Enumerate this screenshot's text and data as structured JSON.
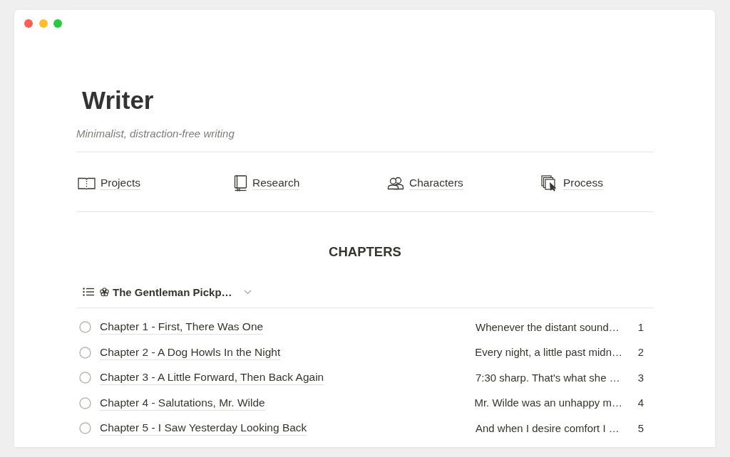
{
  "window": {
    "buttons": [
      {
        "color": "#fe5f57"
      },
      {
        "color": "#febc2e"
      },
      {
        "color": "#28c840"
      }
    ]
  },
  "page": {
    "title": "Writer",
    "subtitle": "Minimalist, distraction-free writing"
  },
  "links": [
    {
      "label": "Projects",
      "kind": "book"
    },
    {
      "label": "Research",
      "kind": "notebook"
    },
    {
      "label": "Characters",
      "kind": "people"
    },
    {
      "label": "Process",
      "kind": "pages"
    }
  ],
  "chapters": {
    "heading": "CHAPTERS",
    "view": {
      "label": "The Gentleman Pickp…"
    },
    "rows": [
      {
        "checked": false,
        "title": "Chapter 1 - First, There Was One",
        "column_2": "Whenever the distant sound…",
        "column_3": "1"
      },
      {
        "checked": false,
        "title": "Chapter 2 - A Dog Howls In the Night",
        "column_2": "Every night, a little past midn…",
        "column_3": "2"
      },
      {
        "checked": false,
        "title": "Chapter 3 - A Little Forward, Then Back Again",
        "column_2": "7:30 sharp. That's what she …",
        "column_3": "3"
      },
      {
        "checked": false,
        "title": "Chapter 4 - Salutations, Mr. Wilde",
        "column_2": "Mr. Wilde was an unhappy m…",
        "column_3": "4"
      },
      {
        "checked": false,
        "title": "Chapter 5 - I Saw Yesterday Looking Back",
        "column_2": "And when I desire comfort I …",
        "column_3": "5"
      }
    ]
  }
}
